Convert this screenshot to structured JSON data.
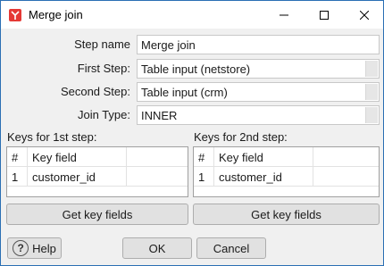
{
  "window": {
    "title": "Merge join"
  },
  "form": {
    "step_name_label": "Step name",
    "step_name_value": "Merge join",
    "first_step_label": "First Step:",
    "first_step_value": "Table input (netstore)",
    "second_step_label": "Second Step:",
    "second_step_value": "Table input (crm)",
    "join_type_label": "Join Type:",
    "join_type_value": "INNER"
  },
  "keys1": {
    "label": "Keys for 1st step:",
    "columns": [
      "#",
      "Key field"
    ],
    "rows": [
      {
        "num": "1",
        "key": "customer_id"
      }
    ],
    "get_button": "Get key fields"
  },
  "keys2": {
    "label": "Keys for 2nd step:",
    "columns": [
      "#",
      "Key field"
    ],
    "rows": [
      {
        "num": "1",
        "key": "customer_id"
      }
    ],
    "get_button": "Get key fields"
  },
  "footer": {
    "help": "Help",
    "ok": "OK",
    "cancel": "Cancel"
  }
}
